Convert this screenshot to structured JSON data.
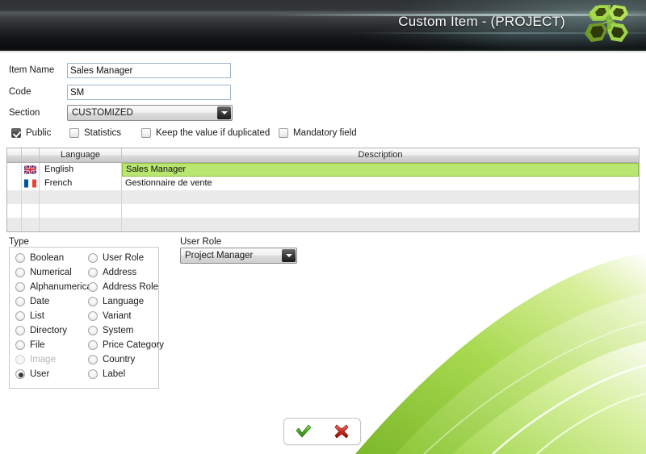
{
  "header": {
    "title": "Custom Item - (PROJECT)",
    "logo_icon": "butterfly-logo-icon"
  },
  "form": {
    "item_name": {
      "label": "Item Name",
      "value": "Sales Manager",
      "placeholder": ""
    },
    "code": {
      "label": "Code",
      "value": "SM",
      "placeholder": ""
    },
    "section": {
      "label": "Section",
      "value": "CUSTOMIZED",
      "options": [
        "CUSTOMIZED"
      ]
    }
  },
  "options": [
    {
      "label": "Public",
      "checked": true
    },
    {
      "label": "Statistics",
      "checked": false
    },
    {
      "label": "Keep the value if duplicated",
      "checked": false
    },
    {
      "label": "Mandatory field",
      "checked": false
    }
  ],
  "table": {
    "columns": [
      "",
      "",
      "Language",
      "Description"
    ],
    "rows": [
      {
        "flag": "uk-flag-icon",
        "language": "English",
        "description": "Sales Manager",
        "selected": true
      },
      {
        "flag": "france-flag-icon",
        "language": "French",
        "description": "Gestionnaire de vente",
        "selected": false
      },
      {
        "flag": "",
        "language": "",
        "description": "",
        "selected": false
      },
      {
        "flag": "",
        "language": "",
        "description": "",
        "selected": false
      },
      {
        "flag": "",
        "language": "",
        "description": "",
        "selected": false
      }
    ]
  },
  "type_group": {
    "label": "Type",
    "column_left": [
      {
        "label": "Boolean",
        "selected": false,
        "disabled": false
      },
      {
        "label": "Numerical",
        "selected": false,
        "disabled": false
      },
      {
        "label": "Alphanumerical",
        "selected": false,
        "disabled": false
      },
      {
        "label": "Date",
        "selected": false,
        "disabled": false
      },
      {
        "label": "List",
        "selected": false,
        "disabled": false
      },
      {
        "label": "Directory",
        "selected": false,
        "disabled": false
      },
      {
        "label": "File",
        "selected": false,
        "disabled": false
      },
      {
        "label": "Image",
        "selected": false,
        "disabled": true
      },
      {
        "label": "User",
        "selected": true,
        "disabled": false
      }
    ],
    "column_right": [
      {
        "label": "User Role",
        "selected": false,
        "disabled": false
      },
      {
        "label": "Address",
        "selected": false,
        "disabled": false
      },
      {
        "label": "Address Role",
        "selected": false,
        "disabled": false
      },
      {
        "label": "Language",
        "selected": false,
        "disabled": false
      },
      {
        "label": "Variant",
        "selected": false,
        "disabled": false
      },
      {
        "label": "System",
        "selected": false,
        "disabled": false
      },
      {
        "label": "Price Category",
        "selected": false,
        "disabled": false
      },
      {
        "label": "Country",
        "selected": false,
        "disabled": false
      },
      {
        "label": "Label",
        "selected": false,
        "disabled": false
      }
    ]
  },
  "user_role": {
    "label": "User Role",
    "value": "Project Manager",
    "options": [
      "Project Manager"
    ]
  },
  "buttons": {
    "confirm": {
      "name": "confirm-button",
      "icon": "green-check-icon"
    },
    "cancel": {
      "name": "cancel-button",
      "icon": "red-cross-icon"
    }
  },
  "colors": {
    "accent_green": "#b9e671",
    "header_dark": "#17191b",
    "swoosh_green": "#8cc63f",
    "input_border": "#9db4cc"
  }
}
